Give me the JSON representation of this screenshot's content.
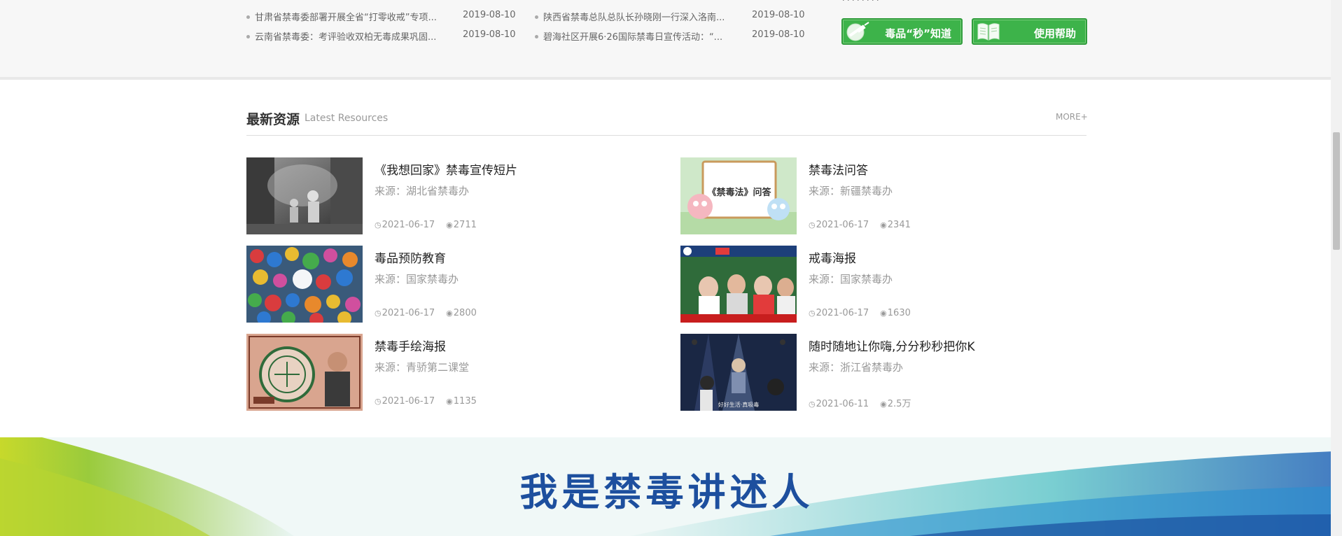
{
  "news": [
    {
      "title": "甘肃省禁毒委部署开展全省“打零收戒”专项...",
      "date": "2019-08-10"
    },
    {
      "title": "陕西省禁毒总队总队长孙晓刚一行深入洛南...",
      "date": "2019-08-10"
    },
    {
      "title": "云南省禁毒委：考评验收双柏无毒成果巩固...",
      "date": "2019-08-10"
    },
    {
      "title": "碧海社区开展6·26国际禁毒日宣传活动：“...",
      "date": "2019-08-10"
    }
  ],
  "promo": {
    "know_label": "毒品“秒”知道",
    "help_label": "使用帮助",
    "accent": "#3db34a"
  },
  "section": {
    "title": "最新资源",
    "subtitle": "Latest Resources",
    "more": "MORE+"
  },
  "resources": [
    {
      "title": "《我想回家》禁毒宣传短片",
      "source": "来源：湖北省禁毒办",
      "date": "2021-06-17",
      "views": "2711"
    },
    {
      "title": "禁毒法问答",
      "source": "来源：新疆禁毒办",
      "date": "2021-06-17",
      "views": "2341"
    },
    {
      "title": "毒品预防教育",
      "source": "来源：国家禁毒办",
      "date": "2021-06-17",
      "views": "2800"
    },
    {
      "title": "戒毒海报",
      "source": "来源：国家禁毒办",
      "date": "2021-06-17",
      "views": "1630"
    },
    {
      "title": "禁毒手绘海报",
      "source": "来源：青骄第二课堂",
      "date": "2021-06-17",
      "views": "1135"
    },
    {
      "title": "随时随地让你嗨,分分秒秒把你K",
      "source": "来源：浙江省禁毒办",
      "date": "2021-06-11",
      "views": "2.5万"
    }
  ],
  "thumb_texts": {
    "law_board": "《禁毒法》问答",
    "video_caption": "好好生活·真吸毒"
  },
  "banner": {
    "text": "我是禁毒讲述人"
  }
}
